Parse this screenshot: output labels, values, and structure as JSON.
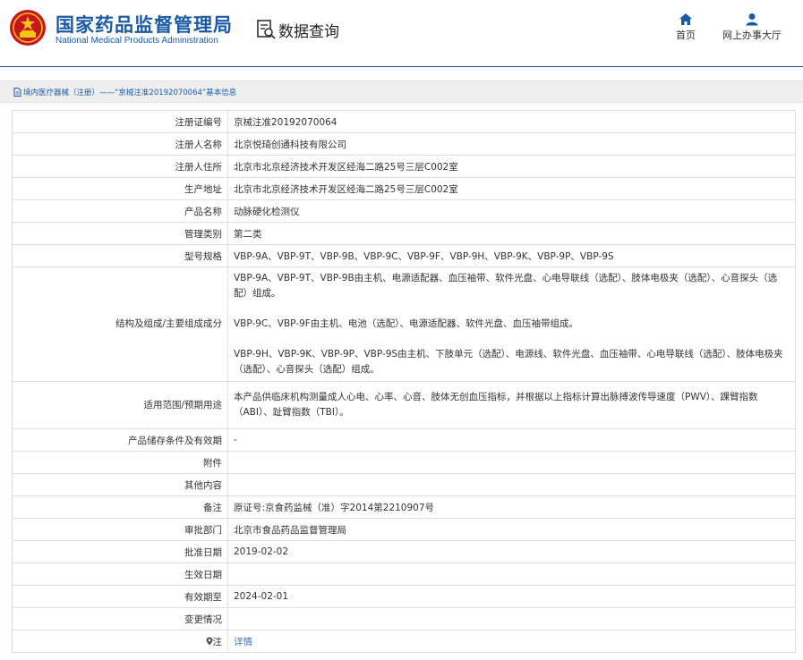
{
  "header": {
    "brand_cn": "国家药品监督管理局",
    "brand_en": "National Medical Products Administration",
    "query_label": "数据查询",
    "nav": [
      {
        "label": "首页",
        "icon": "home-icon"
      },
      {
        "label": "网上办事大厅",
        "icon": "user-icon"
      }
    ],
    "accent_color": "#1b5aa6",
    "emblem_color": "#c8161d"
  },
  "breadcrumb": {
    "text": "境内医疗器械（注册）——“京械注准20192070064”基本信息"
  },
  "table": {
    "rows": [
      {
        "label": "注册证编号",
        "value": "京械注准20192070064"
      },
      {
        "label": "注册人名称",
        "value": "北京悦琦创通科技有限公司"
      },
      {
        "label": "注册人住所",
        "value": "北京市北京经济技术开发区经海二路25号三层C002室"
      },
      {
        "label": "生产地址",
        "value": "北京市北京经济技术开发区经海二路25号三层C002室"
      },
      {
        "label": "产品名称",
        "value": "动脉硬化检测仪"
      },
      {
        "label": "管理类别",
        "value": "第二类"
      },
      {
        "label": "型号规格",
        "value": "VBP-9A、VBP-9T、VBP-9B、VBP-9C、VBP-9F、VBP-9H、VBP-9K、VBP-9P、VBP-9S"
      },
      {
        "label": "结构及组成/主要组成成分",
        "paragraphs": [
          "VBP-9A、VBP-9T、VBP-9B由主机、电源适配器、血压袖带、软件光盘、心电导联线（选配）、肢体电极夹（选配）、心音探头（选配）组成。",
          "VBP-9C、VBP-9F由主机、电池（选配）、电源适配器、软件光盘、血压袖带组成。",
          "VBP-9H、VBP-9K、VBP-9P、VBP-9S由主机、下肢单元（选配）、电源线、软件光盘、血压袖带、心电导联线（选配）、肢体电极夹（选配）、心音探头（选配）组成。"
        ]
      },
      {
        "label": "适用范围/预期用途",
        "value": "本产品供临床机构测量成人心电、心率、心音、肢体无创血压指标，并根据以上指标计算出脉搏波传导速度（PWV）、踝臂指数（ABI）、趾臂指数（TBI）。"
      },
      {
        "label": "产品储存条件及有效期",
        "value": "-"
      },
      {
        "label": "附件",
        "value": ""
      },
      {
        "label": "其他内容",
        "value": ""
      },
      {
        "label": "备注",
        "value": "原证号:京食药监械（准）字2014第2210907号"
      },
      {
        "label": "审批部门",
        "value": "北京市食品药品监督管理局"
      },
      {
        "label": "批准日期",
        "value": "2019-02-02"
      },
      {
        "label": "生效日期",
        "value": ""
      },
      {
        "label": "有效期至",
        "value": "2024-02-01"
      },
      {
        "label": "变更情况",
        "value": ""
      },
      {
        "label": "注",
        "value": "详情",
        "label_icon": "pin-icon"
      }
    ]
  }
}
